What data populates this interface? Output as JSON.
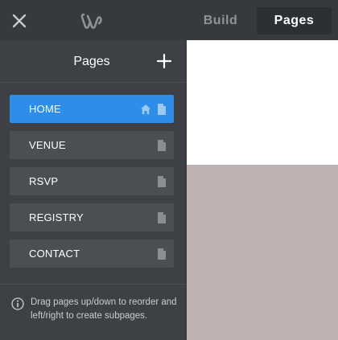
{
  "topbar": {
    "tabs": [
      {
        "label": "Build"
      },
      {
        "label": "Pages"
      }
    ]
  },
  "sidebar": {
    "title": "Pages",
    "pages": [
      {
        "label": "HOME",
        "active": true,
        "home": true
      },
      {
        "label": "VENUE",
        "active": false,
        "home": false
      },
      {
        "label": "RSVP",
        "active": false,
        "home": false
      },
      {
        "label": "REGISTRY",
        "active": false,
        "home": false
      },
      {
        "label": "CONTACT",
        "active": false,
        "home": false
      }
    ],
    "hint": "Drag pages up/down to reorder and left/right to create subpages."
  },
  "colors": {
    "accent": "#2d8de8",
    "sidebar_bg": "#3d4145",
    "item_bg": "#4b4f54",
    "preview_image": "#bdb1b1"
  }
}
